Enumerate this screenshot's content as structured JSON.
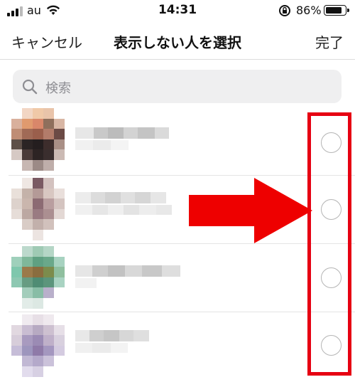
{
  "status_bar": {
    "carrier": "au",
    "time": "14:31",
    "battery_percent": "86%",
    "icons": [
      "signal-icon",
      "wifi-icon",
      "rotation-lock-icon",
      "battery-icon"
    ],
    "battery_level": 0.86
  },
  "header": {
    "cancel_label": "キャンセル",
    "title": "表示しない人を選択",
    "done_label": "完了"
  },
  "search": {
    "placeholder": "検索",
    "icon": "search-icon"
  },
  "list": {
    "rows": [
      {
        "selected": false,
        "avatar": "pixelated"
      },
      {
        "selected": false,
        "avatar": "pixelated"
      },
      {
        "selected": false,
        "avatar": "pixelated"
      },
      {
        "selected": false,
        "avatar": "pixelated"
      }
    ]
  },
  "annotation": {
    "box_color": "#e60012",
    "arrow_color": "#ee0000",
    "arrow_icon": "right-arrow-icon"
  }
}
